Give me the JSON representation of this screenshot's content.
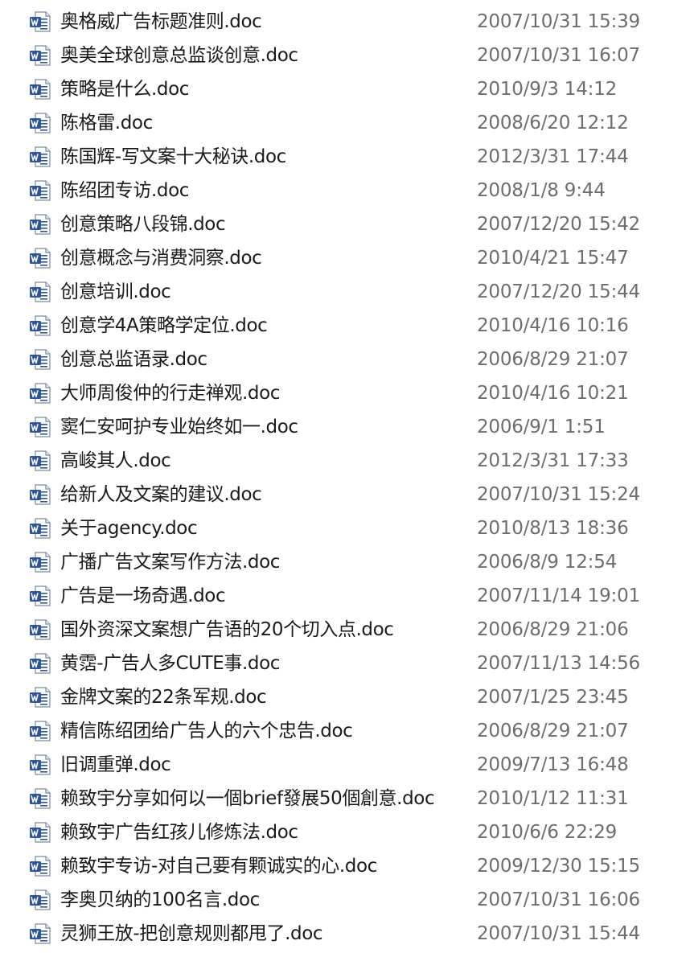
{
  "file_icon": "word-document-icon",
  "colors": {
    "name_text": "#1a1a1a",
    "date_text": "#6d6d6d",
    "icon_blue": "#2b579a"
  },
  "files": [
    {
      "name": "奥格威广告标题准则.doc",
      "modified": "2007/10/31 15:39"
    },
    {
      "name": "奥美全球创意总监谈创意.doc",
      "modified": "2007/10/31 16:07"
    },
    {
      "name": "策略是什么.doc",
      "modified": "2010/9/3 14:12"
    },
    {
      "name": "陈格雷.doc",
      "modified": "2008/6/20 12:12"
    },
    {
      "name": "陈国辉-写文案十大秘诀.doc",
      "modified": "2012/3/31 17:44"
    },
    {
      "name": "陈绍团专访.doc",
      "modified": "2008/1/8 9:44"
    },
    {
      "name": "创意策略八段锦.doc",
      "modified": "2007/12/20 15:42"
    },
    {
      "name": "创意概念与消费洞察.doc",
      "modified": "2010/4/21 15:47"
    },
    {
      "name": "创意培训.doc",
      "modified": "2007/12/20 15:44"
    },
    {
      "name": "创意学4A策略学定位.doc",
      "modified": "2010/4/16 10:16"
    },
    {
      "name": "创意总监语录.doc",
      "modified": "2006/8/29 21:07"
    },
    {
      "name": "大师周俊仲的行走禅观.doc",
      "modified": "2010/4/16 10:21"
    },
    {
      "name": "窦仁安呵护专业始终如一.doc",
      "modified": "2006/9/1 1:51"
    },
    {
      "name": "高峻其人.doc",
      "modified": "2012/3/31 17:33"
    },
    {
      "name": "给新人及文案的建议.doc",
      "modified": "2007/10/31 15:24"
    },
    {
      "name": "关于agency.doc",
      "modified": "2010/8/13 18:36"
    },
    {
      "name": "广播广告文案写作方法.doc",
      "modified": "2006/8/9 12:54"
    },
    {
      "name": "广告是一场奇遇.doc",
      "modified": "2007/11/14 19:01"
    },
    {
      "name": "国外资深文案想广告语的20个切入点.doc",
      "modified": "2006/8/29 21:06"
    },
    {
      "name": "黄霑-广告人多CUTE事.doc",
      "modified": "2007/11/13 14:56"
    },
    {
      "name": "金牌文案的22条军规.doc",
      "modified": "2007/1/25 23:45"
    },
    {
      "name": "精信陈绍团给广告人的六个忠告.doc",
      "modified": "2006/8/29 21:07"
    },
    {
      "name": "旧调重弹.doc",
      "modified": "2009/7/13 16:48"
    },
    {
      "name": "赖致宇分享如何以一個brief發展50個創意.doc",
      "modified": "2010/1/12 11:31"
    },
    {
      "name": "赖致宇广告红孩儿修炼法.doc",
      "modified": "2010/6/6 22:29"
    },
    {
      "name": "赖致宇专访-对自己要有颗诚实的心.doc",
      "modified": "2009/12/30 15:15"
    },
    {
      "name": "李奥贝纳的100名言.doc",
      "modified": "2007/10/31 16:06"
    },
    {
      "name": "灵狮王放-把创意规则都甩了.doc",
      "modified": "2007/10/31 15:44"
    }
  ]
}
